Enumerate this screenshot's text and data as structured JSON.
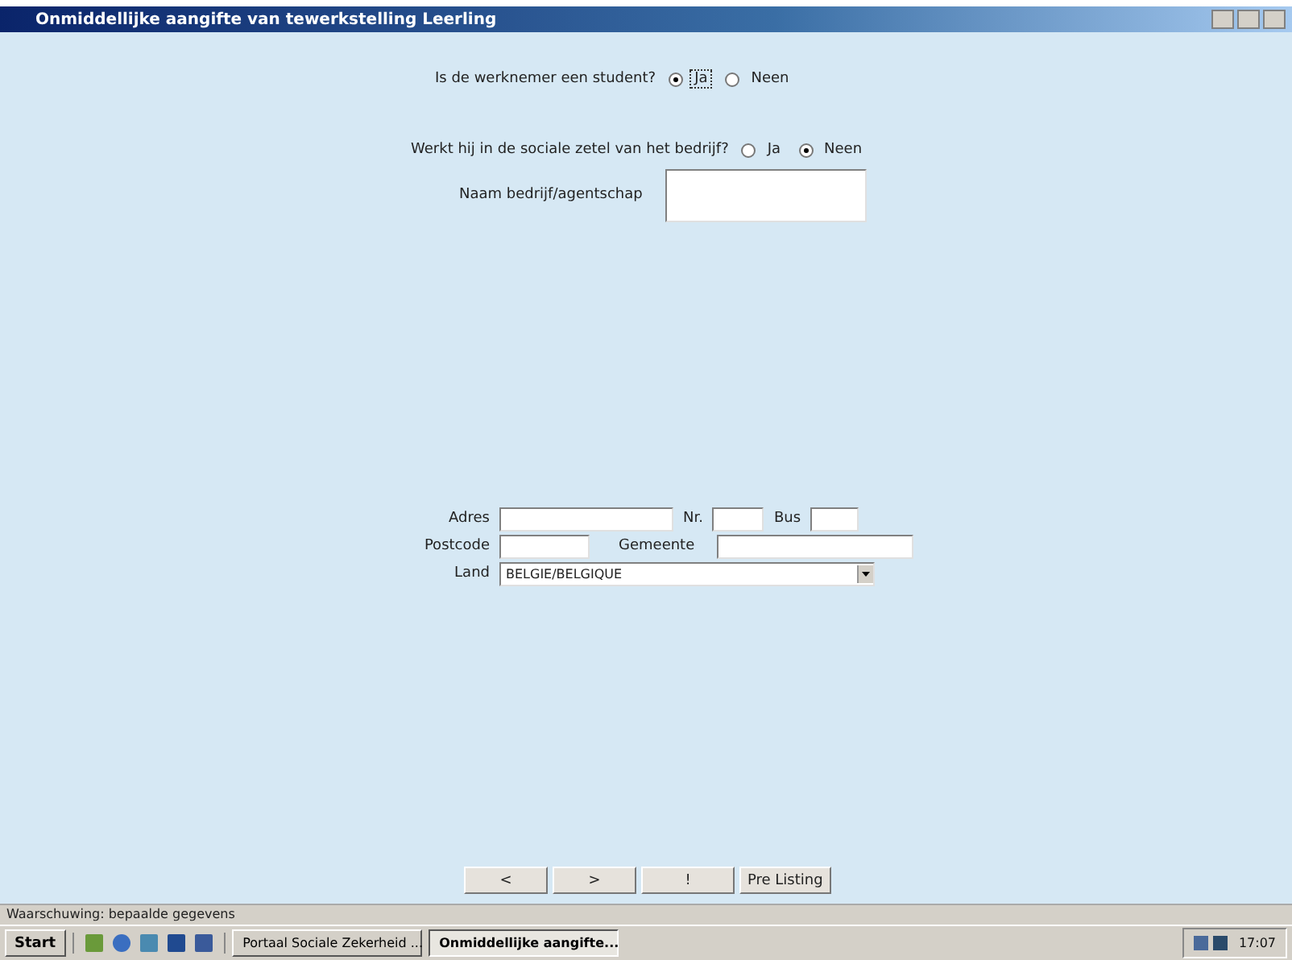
{
  "window": {
    "title": "Onmiddellijke aangifte van tewerkstelling Leerling"
  },
  "questions": [
    {
      "label": "Is de werknemer een student?",
      "options": [
        {
          "label": "Ja",
          "selected": true,
          "focused": true
        },
        {
          "label": "Neen",
          "selected": false,
          "focused": false
        }
      ]
    },
    {
      "label": "Werkt hij in de sociale zetel van het bedrijf?",
      "options": [
        {
          "label": "Ja",
          "selected": false,
          "focused": false
        },
        {
          "label": "Neen",
          "selected": true,
          "focused": false
        }
      ]
    }
  ],
  "company_field": {
    "label": "Naam bedrijf/agentschap"
  },
  "address": {
    "street_label": "Adres",
    "number_label": "Nr.",
    "box_label": "Bus",
    "postcode_label": "Postcode",
    "city_label": "Gemeente",
    "country_label": "Land",
    "country_value": "BELGIE/BELGIQUE"
  },
  "nav_buttons": [
    "<",
    ">",
    "!",
    "Pre Listing"
  ],
  "status_bar": "Waarschuwing: bepaalde gegevens",
  "taskbar": {
    "start": "Start",
    "tasks": [
      {
        "label": "Portaal Sociale Zekerheid ...",
        "selected": false
      },
      {
        "label": "Onmiddellijke aangifte...",
        "selected": true
      }
    ],
    "clock": "17:07"
  }
}
